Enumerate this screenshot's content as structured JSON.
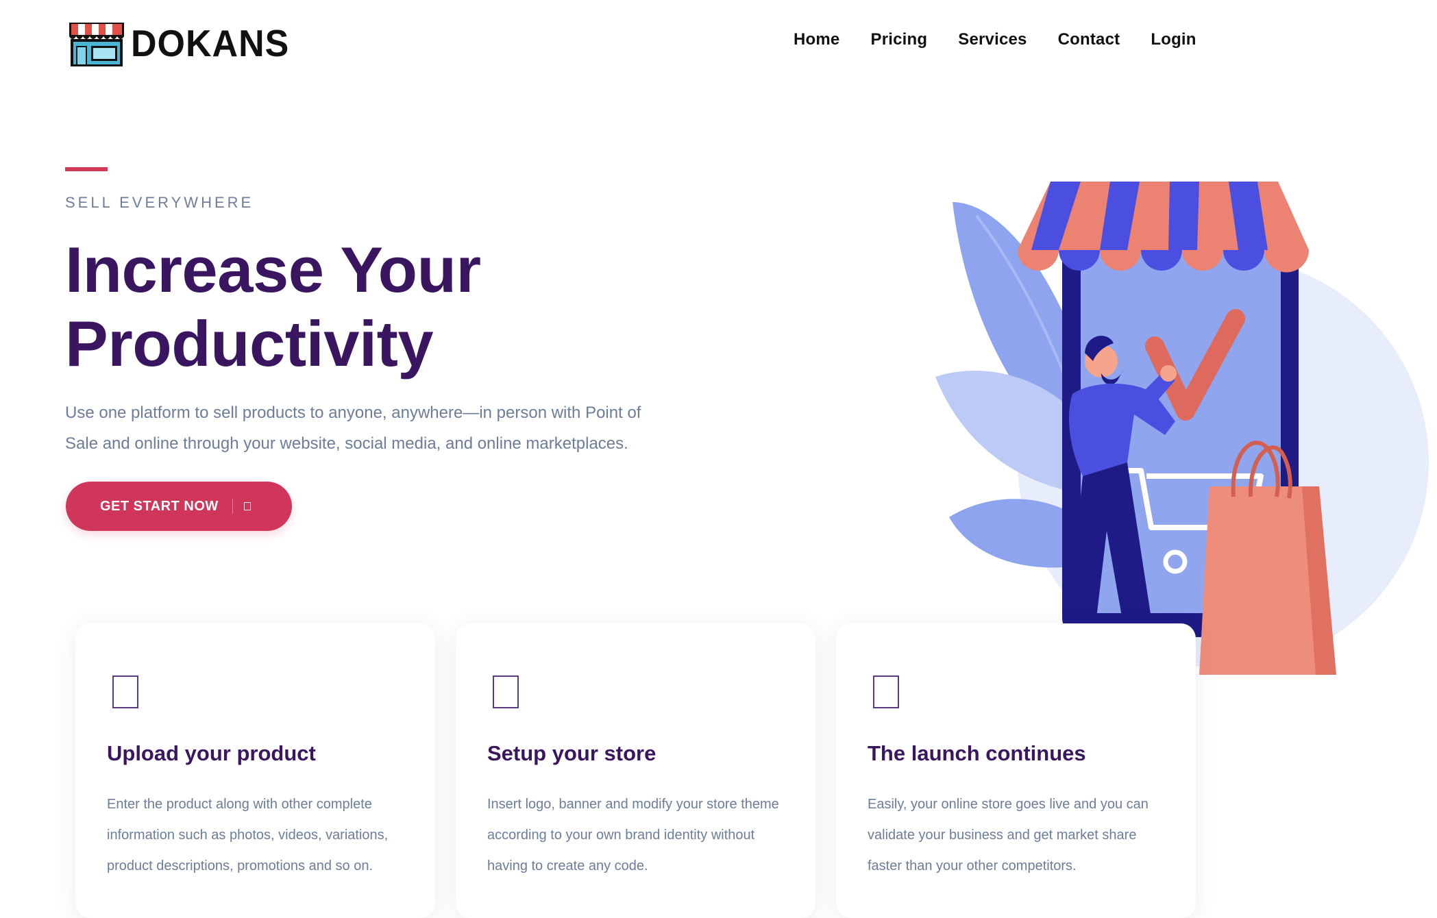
{
  "brand": {
    "name": "DOKANS"
  },
  "nav": {
    "items": [
      "Home",
      "Pricing",
      "Services",
      "Contact",
      "Login"
    ]
  },
  "hero": {
    "eyebrow": "SELL EVERYWHERE",
    "title": "Increase Your Productivity",
    "description": "Use one platform to sell products to anyone, anywhere—in person with Point of Sale and online through your website, social media, and online marketplaces.",
    "cta_label": "GET START NOW",
    "cta_icon": "arrow-right-icon"
  },
  "illustration": {
    "subject": "shop-with-checkmark-and-shopping-bag",
    "icon": "storefront-illustration"
  },
  "features": [
    {
      "icon": "upload-icon",
      "title": "Upload your product",
      "text": "Enter the product along with other complete information such as photos, videos, variations, product descriptions, promotions and so on."
    },
    {
      "icon": "store-icon",
      "title": "Setup your store",
      "text": "Insert logo, banner and modify your store theme according to your own brand identity without having to create any code."
    },
    {
      "icon": "rocket-icon",
      "title": "The launch continues",
      "text": "Easily, your online store goes live and you can validate your business and get market share faster than your other competitors."
    }
  ],
  "colors": {
    "accent": "#d0365a",
    "heading": "#3b1660",
    "body_text": "#6c7d99",
    "illustration_blue": "#8fa6ef",
    "illustration_indigo": "#3a3fd8",
    "illustration_coral": "#ee8070"
  }
}
